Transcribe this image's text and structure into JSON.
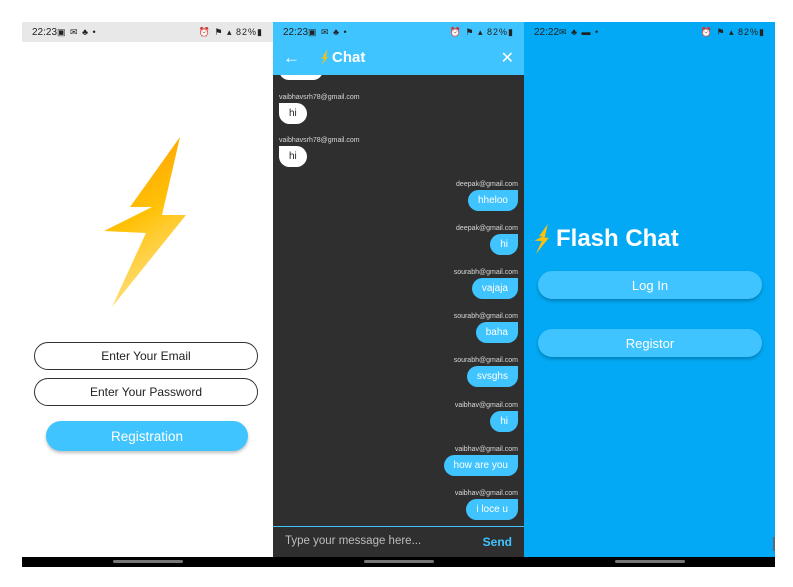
{
  "colors": {
    "accent": "#40c4ff",
    "brand_bg": "#03a9f4",
    "chat_bg": "#2f2f2f",
    "bolt": "#ffb300"
  },
  "screen1": {
    "status": {
      "time": "22:23",
      "notif_icons": "▣ ✉ ♣ •",
      "right": "⏰ ⚑ ▴ 82%▮"
    },
    "email_placeholder": "Enter Your Email",
    "password_placeholder": "Enter Your Password",
    "register_label": "Registration"
  },
  "screen2": {
    "status": {
      "time": "22:23",
      "notif_icons": "▣ ✉ ♣ •",
      "right": "⏰ ⚑ ▴ 82%▮"
    },
    "title": "Chat",
    "messages": [
      {
        "sender": "vaibhavsrh78@gmail.com",
        "text": "hi",
        "side": "left"
      },
      {
        "sender": "vaibhavsrh78@gmail.com",
        "text": "hi",
        "side": "left"
      },
      {
        "sender": "deepak@gmail.com",
        "text": "hheloo",
        "side": "right"
      },
      {
        "sender": "deepak@gmail.com",
        "text": "hi",
        "side": "right"
      },
      {
        "sender": "sourabh@gmail.com",
        "text": "vajaja",
        "side": "right"
      },
      {
        "sender": "sourabh@gmail.com",
        "text": "baha",
        "side": "right"
      },
      {
        "sender": "sourabh@gmail.com",
        "text": "svsghs",
        "side": "right"
      },
      {
        "sender": "vaibhav@gmail.com",
        "text": "hi",
        "side": "right"
      },
      {
        "sender": "vaibhav@gmail.com",
        "text": "how are you",
        "side": "right"
      },
      {
        "sender": "vaibhav@gmail.com",
        "text": "i loce u",
        "side": "right"
      }
    ],
    "input_placeholder": "Type your message here...",
    "send_label": "Send"
  },
  "screen3": {
    "status": {
      "time": "22:22",
      "notif_icons": "✉ ♣ ▬ •",
      "right": "⏰ ⚑ ▴ 82%▮"
    },
    "brand": "Flash Chat",
    "login_label": "Log In",
    "register_label": "Registor"
  }
}
